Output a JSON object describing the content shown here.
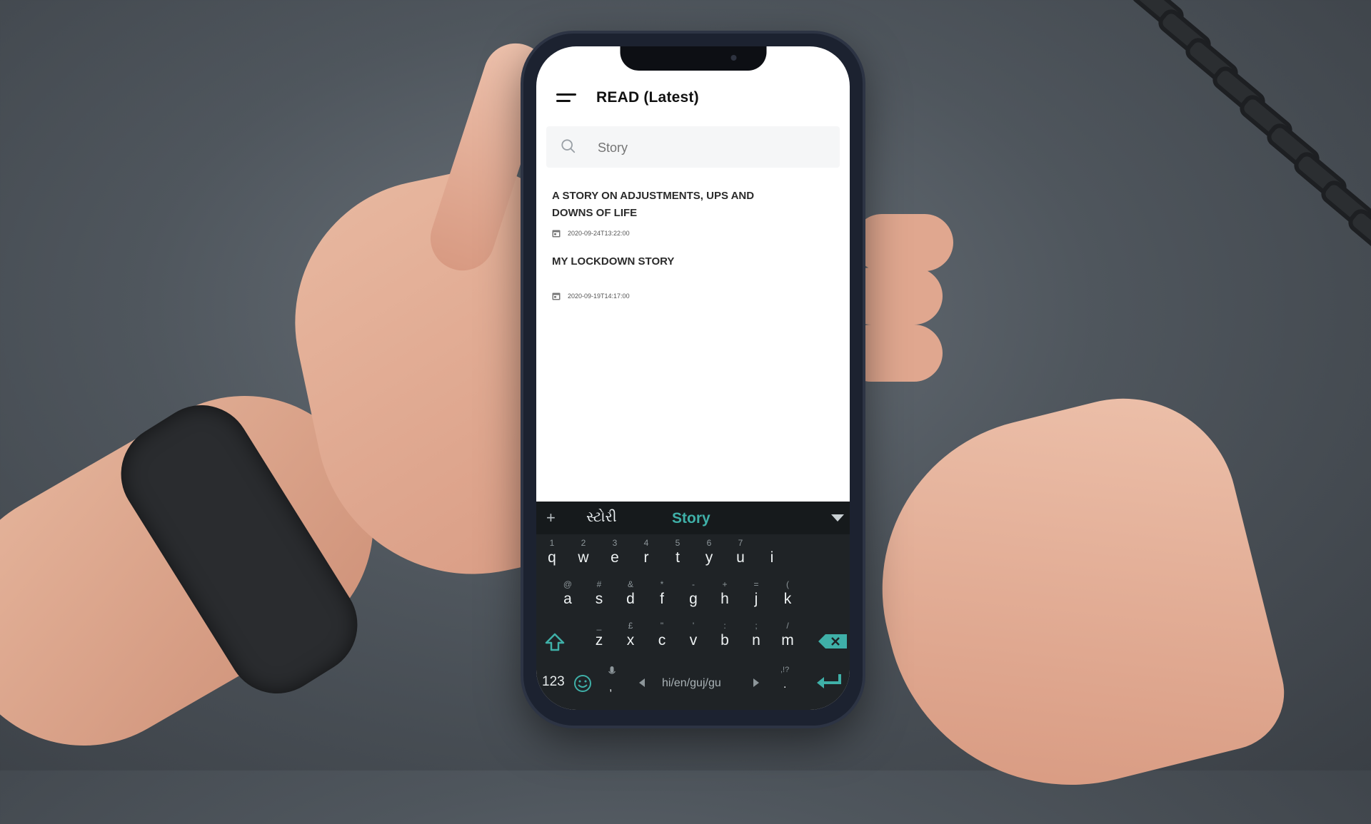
{
  "app": {
    "title": "READ  (Latest)"
  },
  "search": {
    "placeholder": "Story"
  },
  "stories": [
    {
      "title": "A STORY ON ADJUSTMENTS, UPS AND DOWNS OF LIFE",
      "date": "2020-09-24T13:22:00"
    },
    {
      "title": "MY LOCKDOWN STORY",
      "date": "2020-09-19T14:17:00"
    }
  ],
  "keyboard": {
    "suggestion_add": "+",
    "suggestions": [
      "સ્ટોરી",
      "Story"
    ],
    "row1": [
      {
        "k": "q",
        "a": "1"
      },
      {
        "k": "w",
        "a": "2"
      },
      {
        "k": "e",
        "a": "3"
      },
      {
        "k": "r",
        "a": "4"
      },
      {
        "k": "t",
        "a": "5"
      },
      {
        "k": "y",
        "a": "6"
      },
      {
        "k": "u",
        "a": "7"
      },
      {
        "k": "i",
        "a": ""
      }
    ],
    "row2": [
      {
        "k": "a",
        "a": "@"
      },
      {
        "k": "s",
        "a": "#"
      },
      {
        "k": "d",
        "a": "&"
      },
      {
        "k": "f",
        "a": "*"
      },
      {
        "k": "g",
        "a": "-"
      },
      {
        "k": "h",
        "a": "+"
      },
      {
        "k": "j",
        "a": "="
      },
      {
        "k": "k",
        "a": "("
      }
    ],
    "row3": [
      {
        "k": "z",
        "a": "_"
      },
      {
        "k": "x",
        "a": "£"
      },
      {
        "k": "c",
        "a": "\""
      },
      {
        "k": "v",
        "a": "'"
      },
      {
        "k": "b",
        "a": ":"
      },
      {
        "k": "n",
        "a": ";"
      },
      {
        "k": "m",
        "a": "/"
      }
    ],
    "numbers_label": "123",
    "comma": ",",
    "language": "hi/en/guj/gu",
    "punct_top": ",!?",
    "period": "."
  },
  "colors": {
    "accent": "#3fb0a8",
    "keyboard_bg": "#1f2326",
    "background": "#4f565d"
  }
}
